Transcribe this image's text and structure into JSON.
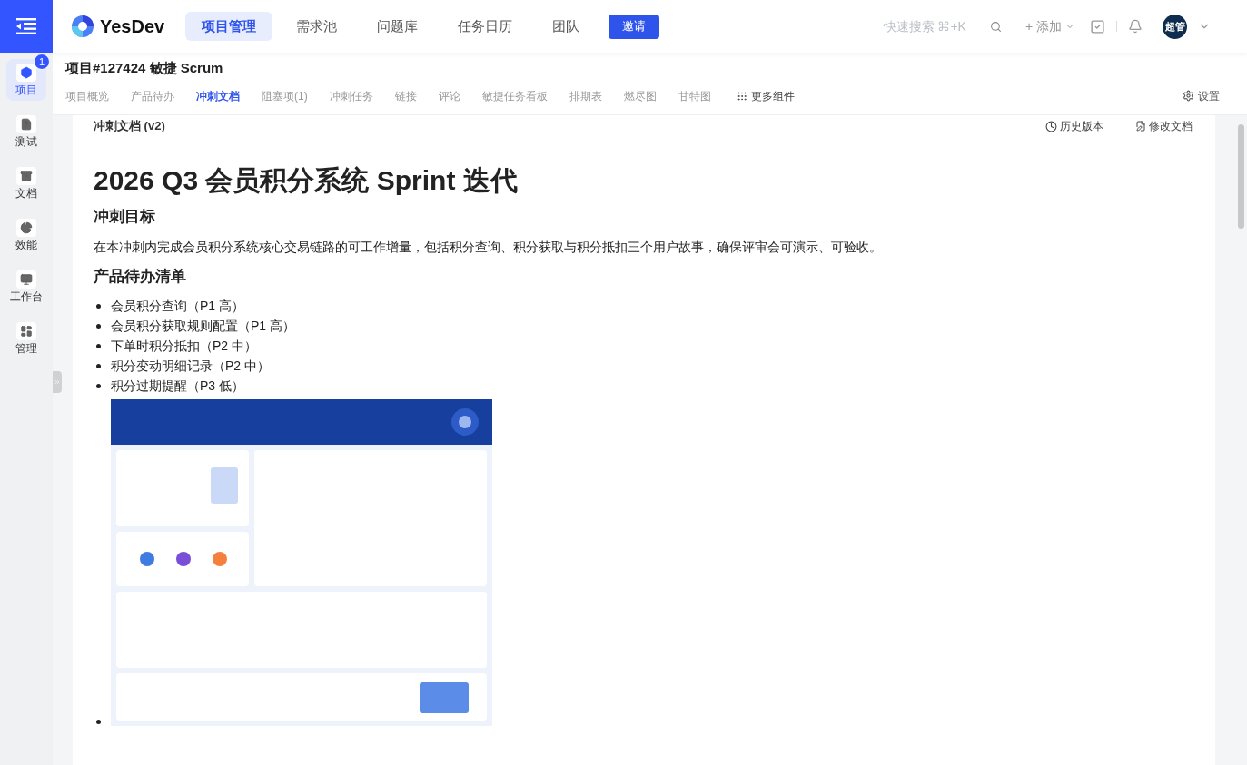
{
  "header": {
    "logo": "YesDev",
    "nav": [
      {
        "label": "项目管理",
        "selected": true
      },
      {
        "label": "需求池",
        "selected": false
      },
      {
        "label": "问题库",
        "selected": false
      },
      {
        "label": "任务日历",
        "selected": false
      },
      {
        "label": "团队",
        "selected": false
      }
    ],
    "invite_button": "邀请",
    "search_hint": "快速搜索 ⌘+K",
    "add_button": "+ 添加",
    "avatar": "超管"
  },
  "sidebar": {
    "items": [
      {
        "label": "项目",
        "selected": true,
        "badge": "1"
      },
      {
        "label": "测试",
        "selected": false
      },
      {
        "label": "文档",
        "selected": false
      },
      {
        "label": "效能",
        "selected": false
      },
      {
        "label": "工作台",
        "selected": false
      },
      {
        "label": "管理",
        "selected": false
      }
    ]
  },
  "project": {
    "title": "项目#127424 敏捷 Scrum",
    "tabs": [
      {
        "label": "项目概览",
        "selected": false
      },
      {
        "label": "产品待办",
        "selected": false
      },
      {
        "label": "冲刺文档",
        "selected": true
      },
      {
        "label": "阻塞项(1)",
        "selected": false
      },
      {
        "label": "冲刺任务",
        "selected": false
      },
      {
        "label": "链接",
        "selected": false
      },
      {
        "label": "评论",
        "selected": false
      },
      {
        "label": "敏捷任务看板",
        "selected": false
      },
      {
        "label": "排期表",
        "selected": false
      },
      {
        "label": "燃尽图",
        "selected": false
      },
      {
        "label": "甘特图",
        "selected": false
      }
    ],
    "more_components": "更多组件",
    "settings": "设置"
  },
  "document": {
    "label": "冲刺文档 (v2)",
    "history_button": "历史版本",
    "edit_button": "修改文档",
    "title": "2026 Q3 会员积分系统 Sprint 迭代",
    "goal_heading": "冲刺目标",
    "goal_text": "在本冲刺内完成会员积分系统核心交易链路的可工作增量，包括积分查询、积分获取与积分抵扣三个用户故事，确保评审会可演示、可验收。",
    "backlog_heading": "产品待办清单",
    "backlog_items": [
      "会员积分查询（P1 高）",
      "会员积分获取规则配置（P1 高）",
      "下单时积分抵扣（P2 中）",
      "积分变动明细记录（P2 中）",
      "积分过期提醒（P3 低）"
    ],
    "image": {
      "kind": "picture"
    }
  }
}
